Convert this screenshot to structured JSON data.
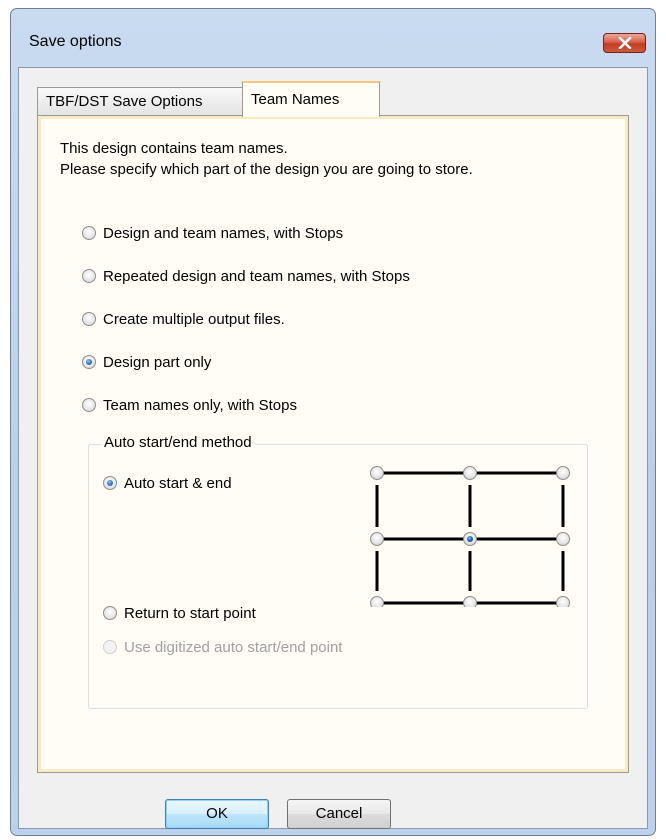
{
  "window": {
    "title": "Save options",
    "close_icon": "close-icon"
  },
  "tabs": [
    {
      "label": "TBF/DST Save Options",
      "active": false
    },
    {
      "label": "Team Names",
      "active": true
    }
  ],
  "intro": {
    "line1": "This design contains team names.",
    "line2": "Please specify which part of the design you are going to store."
  },
  "store_options": [
    {
      "label": "Design and team names, with Stops",
      "checked": false
    },
    {
      "label": "Repeated design and team names, with Stops",
      "checked": false
    },
    {
      "label": "Create multiple output files.",
      "checked": false
    },
    {
      "label": "Design part only",
      "checked": true
    },
    {
      "label": "Team names only, with Stops",
      "checked": false
    }
  ],
  "auto_group": {
    "title": "Auto start/end method",
    "options": [
      {
        "label": "Auto start & end",
        "checked": true,
        "enabled": true
      },
      {
        "label": "Return to start point",
        "checked": false,
        "enabled": true
      },
      {
        "label": "Use digitized auto start/end point",
        "checked": false,
        "enabled": false
      }
    ],
    "point_grid_selected": "middle-center"
  },
  "buttons": {
    "ok": "OK",
    "cancel": "Cancel"
  },
  "colors": {
    "window_frame": "#c4d7ef",
    "close_button": "#c94a30",
    "tab_panel_bg": "#fffdf6",
    "ok_button": "#bee6fd"
  }
}
